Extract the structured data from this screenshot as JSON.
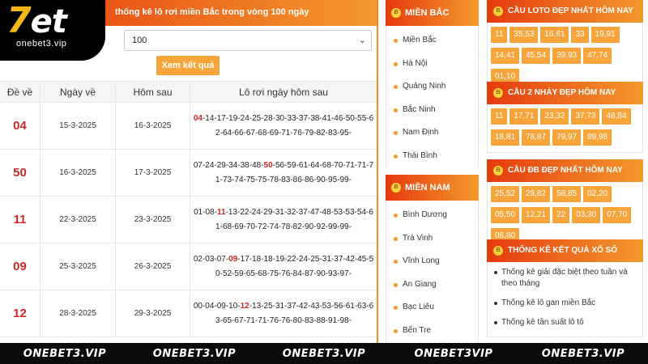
{
  "logo": {
    "mark_prefix": "7",
    "mark_text": "et",
    "sub": "onebet3.vip"
  },
  "left": {
    "title": "thống kê lô rơi miền Bắc trong vòng 100 ngày",
    "select_value": "100",
    "submit_label": "Xem kết quả",
    "headers": [
      "Đề về",
      "Ngày về",
      "Hôm sau",
      "Lô rơi ngày hôm sau"
    ],
    "rows": [
      {
        "de": "04",
        "ngay_ve": "15-3-2025",
        "hom_sau": "16-3-2025",
        "lo_before": "",
        "lo_hl": "04",
        "lo_after": "-14-17-19-24-25-28-30-33-37-38-41-46-50-55-62-64-66-67-68-69-71-76-79-82-83-95-"
      },
      {
        "de": "50",
        "ngay_ve": "16-3-2025",
        "hom_sau": "17-3-2025",
        "lo_before": "07-24-29-34-38-48-",
        "lo_hl": "50",
        "lo_after": "-56-59-61-64-68-70-71-71-71-73-74-75-75-78-83-86-86-90-95-99-"
      },
      {
        "de": "11",
        "ngay_ve": "22-3-2025",
        "hom_sau": "23-3-2025",
        "lo_before": "01-08-",
        "lo_hl": "11",
        "lo_after": "-13-22-24-29-31-32-37-47-48-53-53-54-61-68-69-70-72-74-78-82-90-92-99-99-"
      },
      {
        "de": "09",
        "ngay_ve": "25-3-2025",
        "hom_sau": "26-3-2025",
        "lo_before": "02-03-07-",
        "lo_hl": "09",
        "lo_after": "-17-18-18-19-22-24-25-31-37-42-45-50-52-59-65-68-75-76-84-87-90-93-97-"
      },
      {
        "de": "12",
        "ngay_ve": "28-3-2025",
        "hom_sau": "29-3-2025",
        "lo_before": "00-04-09-10-",
        "lo_hl": "12",
        "lo_after": "-13-25-31-37-42-43-53-56-61-63-63-65-67-71-71-76-76-80-83-88-91-98-"
      }
    ]
  },
  "mien_bac": {
    "title": "MIỀN BẮC",
    "items": [
      "Miền Bắc",
      "Hà Nội",
      "Quảng Ninh",
      "Bắc Ninh",
      "Nam Định",
      "Thái Bình"
    ]
  },
  "mien_nam": {
    "title": "MIỀN NAM",
    "items": [
      "Bình Dương",
      "Trà Vinh",
      "Vĩnh Long",
      "An Giang",
      "Bạc Liêu",
      "Bến Tre"
    ]
  },
  "loto": {
    "title": "CẦU LOTO ĐẸP NHẤT HÔM NAY",
    "tags": [
      "11",
      "35,53",
      "16,61",
      "33",
      "19,91",
      "14,41",
      "45,54",
      "39,93",
      "47,74",
      "01,10"
    ]
  },
  "cau2": {
    "title": "CẦU 2 NHÁY ĐẸP HÔM NAY",
    "tags": [
      "11",
      "17,71",
      "23,32",
      "37,73",
      "48,84",
      "18,81",
      "78,87",
      "79,97",
      "89,98"
    ]
  },
  "caudb": {
    "title": "CẦU ĐB ĐẸP NHẤT HÔM NAY",
    "tags": [
      "25,52",
      "28,82",
      "58,85",
      "02,20",
      "05,50",
      "12,21",
      "22",
      "03,30",
      "07,70",
      "08,80"
    ]
  },
  "thongke": {
    "title": "THỐNG KÊ KẾT QUẢ XỔ SỐ",
    "links": [
      "Thống kê giải đặc biệt theo tuần và theo tháng",
      "Thống kê lô gan miền Bắc",
      "Thống kê tần suất lô tô"
    ]
  },
  "watermarks": [
    "ONEBET3.VIP",
    "ONEBET3.VIP",
    "ONEBET3.VIP",
    "ONEBET3VIP",
    "ONEBET3.VIP"
  ],
  "colors": {
    "accent_red": "#e63a0f",
    "accent_orange": "#f39a2c",
    "number_red": "#c9282b",
    "tag_orange": "#f7a43b"
  }
}
